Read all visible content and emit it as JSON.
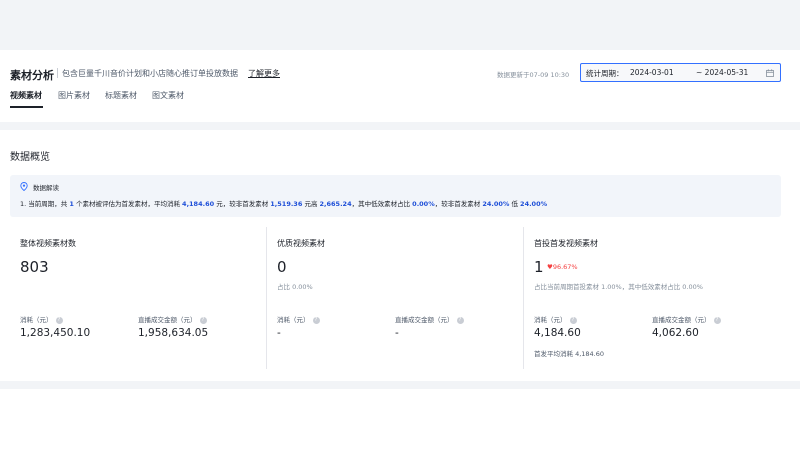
{
  "header": {
    "title": "素材分析",
    "subtitle": "包含巨量千川音价计划和小店随心推订单投放数据",
    "learn_more": "了解更多",
    "update_time": "数据更新于07-09 10:30",
    "date_range": {
      "label": "统计周期：",
      "start": "2024-03-01",
      "end": "~ 2024-05-31"
    }
  },
  "tabs": [
    {
      "label": "视频素材",
      "active": true
    },
    {
      "label": "图片素材",
      "active": false
    },
    {
      "label": "标题素材",
      "active": false
    },
    {
      "label": "图文素材",
      "active": false
    }
  ],
  "overview": {
    "title": "数据概览",
    "info": {
      "heading": "数据解读",
      "seg1": "1. 当前周期，共",
      "v1": "1",
      "seg2": "个素材被评估为首发素材，平均消耗",
      "v2": "4,184.60",
      "seg3": "元，较非首发素材",
      "v3": "1,519.36",
      "seg4": "元高",
      "v4": "2,665.24",
      "seg5": "，其中低效素材占比",
      "v5": "0.00%",
      "seg6": "，较非首发素材",
      "v6": "24.00%",
      "seg7": "低",
      "v7": "24.00%"
    },
    "cards": [
      {
        "title": "整体视频素材数",
        "value": "803",
        "sub": "",
        "trend": "",
        "metrics": [
          {
            "label": "消耗（元）",
            "value": "1,283,450.10"
          },
          {
            "label": "直播成交金额（元）",
            "value": "1,958,634.05"
          }
        ],
        "footer": ""
      },
      {
        "title": "优质视频素材",
        "value": "0",
        "sub": "占比 0.00%",
        "trend": "",
        "metrics": [
          {
            "label": "消耗（元）",
            "value": "-"
          },
          {
            "label": "直播成交金额（元）",
            "value": "-"
          }
        ],
        "footer": ""
      },
      {
        "title": "首投首发视频素材",
        "value": "1",
        "sub": "占比当前周期首投素材 1.00%，其中低效素材占比 0.00%",
        "trend": "♥96.67%",
        "metrics": [
          {
            "label": "消耗（元）",
            "value": "4,184.60"
          },
          {
            "label": "直播成交金额（元）",
            "value": "4,062.60"
          }
        ],
        "footer": "首发平均消耗 4,184.60"
      }
    ]
  },
  "colors": {
    "accent": "#3370ff",
    "highlight": "#1e4fd8",
    "trend": "#f53f3f"
  }
}
